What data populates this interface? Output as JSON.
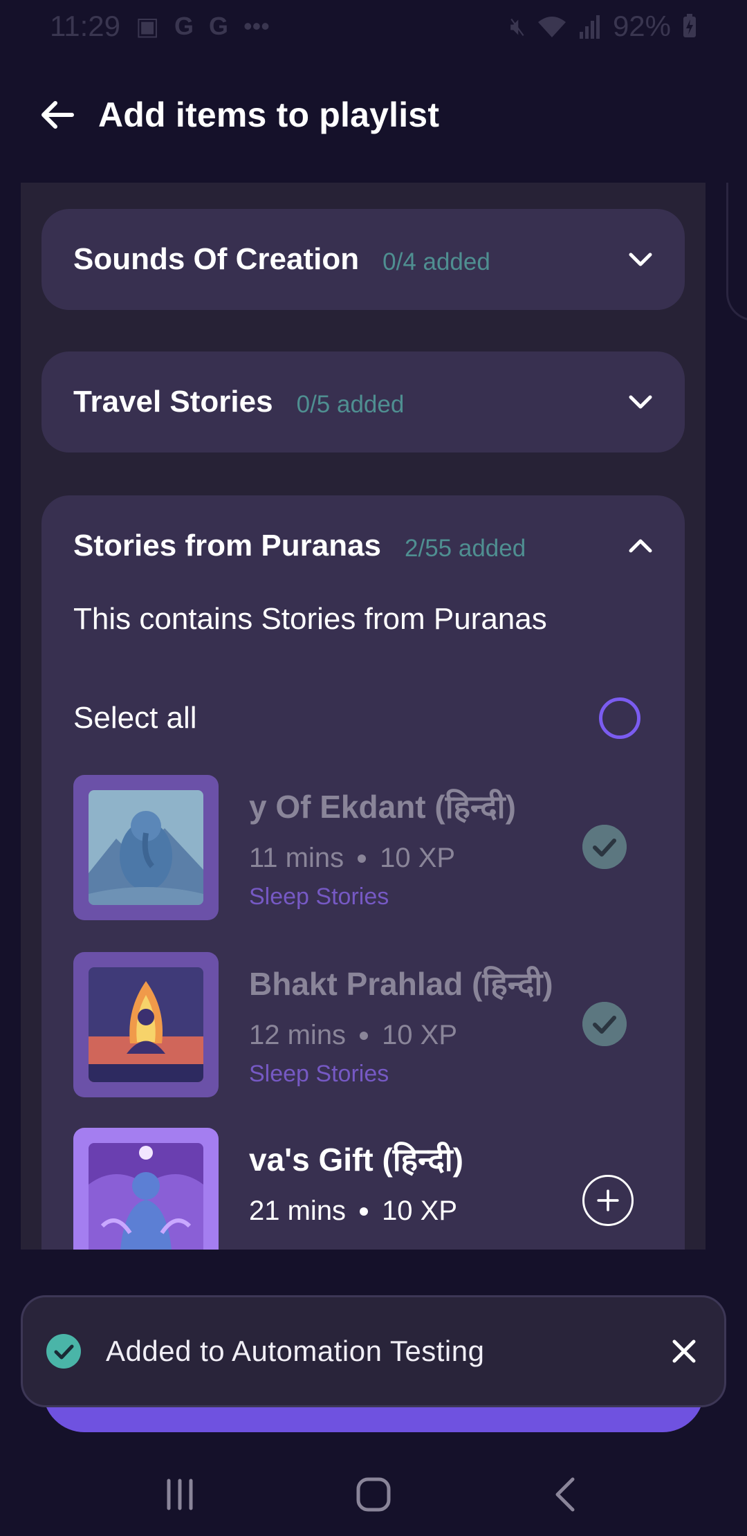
{
  "status_bar": {
    "time": "11:29",
    "left_icons": [
      "teams-icon",
      "google-icon",
      "google-icon",
      "more-dots-icon"
    ],
    "battery": "92%",
    "right_icons": [
      "mute-icon",
      "wifi-icon",
      "signal-icon",
      "battery-charging-icon"
    ]
  },
  "header": {
    "title": "Add items to playlist",
    "back_icon": "arrow-left-icon"
  },
  "sections": [
    {
      "title": "Sounds Of Creation",
      "count": "0/4 added",
      "expanded": false
    },
    {
      "title": "Travel Stories",
      "count": "0/5 added",
      "expanded": false
    },
    {
      "title": "Stories from Puranas",
      "count": "2/55 added",
      "expanded": true,
      "description": "This contains Stories from Puranas",
      "select_all_label": "Select all",
      "items": [
        {
          "title": "y Of Ekdant (हिन्दी)",
          "duration": "11 mins",
          "xp": "10 XP",
          "category": "Sleep Stories",
          "state": "added"
        },
        {
          "title": "Bhakt Prahlad (हिन्दी)",
          "duration": "12 mins",
          "xp": "10 XP",
          "category": "Sleep Stories",
          "state": "added"
        },
        {
          "title": "va's Gift (हिन्दी)",
          "duration": "21 mins",
          "xp": "10 XP",
          "category": "",
          "state": "add"
        }
      ]
    }
  ],
  "snackbar": {
    "message": "Added to Automation Testing",
    "icon": "check-circle-icon",
    "close_icon": "close-icon"
  },
  "colors": {
    "background": "#15112a",
    "card": "#383050",
    "accent": "#7b5cf0",
    "count_teal": "#4f8f91",
    "category_purple": "#7659c4",
    "snack_check": "#4ab5a8"
  },
  "nav_bar": [
    "recents-icon",
    "home-icon",
    "back-icon"
  ]
}
